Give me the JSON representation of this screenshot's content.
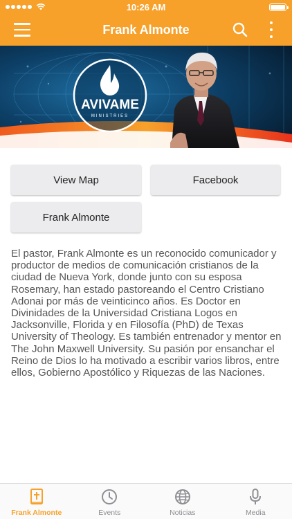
{
  "status_bar": {
    "time": "10:26 AM"
  },
  "nav": {
    "title": "Frank Almonte"
  },
  "hero": {
    "logo_text": "AVIVAME",
    "logo_subtext": "MINISTRIES"
  },
  "buttons": {
    "view_map": "View Map",
    "facebook": "Facebook",
    "frank_almonte": "Frank Almonte"
  },
  "bio": "El pastor, Frank Almonte es un reconocido comunicador y productor de medios de comunicación cristianos de la ciudad de Nueva York, donde junto con su esposa Rosemary, han estado pastoreando el Centro Cristiano Adonai por más de veinticinco años. Es Doctor en Divinidades de la Universidad Cristiana Logos en Jacksonville, Florida y en Filosofía (PhD) de Texas University of Theology. Es también entrenador y mentor en The John Maxwell University. Su pasión por ensanchar el Reino de Dios lo ha motivado a escribir varios libros, entre ellos, Gobierno Apostólico y Riquezas de las Naciones.",
  "tabs": [
    {
      "label": "Frank Almonte",
      "icon": "bible-icon",
      "active": true
    },
    {
      "label": "Events",
      "icon": "clock-icon",
      "active": false
    },
    {
      "label": "Noticias",
      "icon": "globe-icon",
      "active": false
    },
    {
      "label": "Media",
      "icon": "microphone-icon",
      "active": false
    }
  ],
  "colors": {
    "accent": "#f7a12b",
    "inactive": "#8e8e93"
  }
}
